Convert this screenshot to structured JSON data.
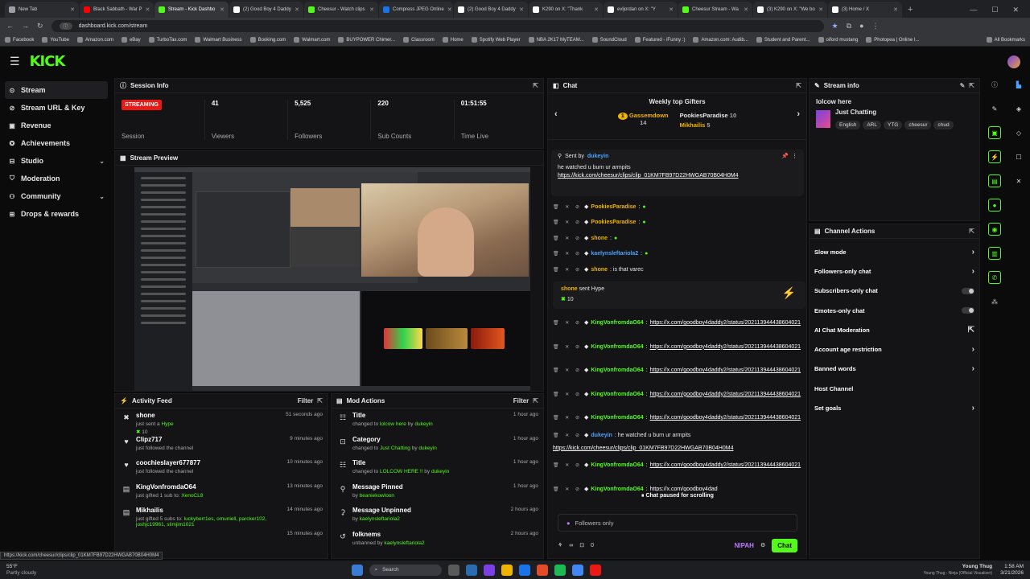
{
  "browser": {
    "tabs": [
      {
        "title": "New Tab",
        "color": "#9aa0a6",
        "active": false
      },
      {
        "title": "Black Sabbath - War P",
        "color": "#ff0000",
        "active": false
      },
      {
        "title": "Stream - Kick Dashbo",
        "color": "#53fc18",
        "active": true
      },
      {
        "title": "(2) Good Boy 4 Daddy",
        "color": "#ffffff",
        "active": false
      },
      {
        "title": "Cheesur - Watch clips",
        "color": "#53fc18",
        "active": false
      },
      {
        "title": "Compress JPEG Online",
        "color": "#1a73e8",
        "active": false
      },
      {
        "title": "(2) Good Boy 4 Daddy",
        "color": "#ffffff",
        "active": false
      },
      {
        "title": "K290 on X: \"Thank",
        "color": "#ffffff",
        "active": false
      },
      {
        "title": "evljordan on X: \"Y",
        "color": "#ffffff",
        "active": false
      },
      {
        "title": "Cheesur Stream - Wa",
        "color": "#53fc18",
        "active": false
      },
      {
        "title": "(3) K290 on X: \"We bo",
        "color": "#ffffff",
        "active": false
      },
      {
        "title": "(3) Home / X",
        "color": "#ffffff",
        "active": false
      }
    ],
    "url": "dashboard.kick.com/stream",
    "bookmarks": [
      "Facebook",
      "YouTube",
      "Amazon.com",
      "eBay",
      "TurboTax.com",
      "Walmart Business",
      "Booking.com",
      "Walmart.com",
      "BUYPOWER Chimer...",
      "Classroom",
      "Home",
      "Spotify Web Player",
      "NBA 2K17 MyTEAM...",
      "SoundCloud",
      "Featured - iFunny :)",
      "Amazon.com: Audib...",
      "Student and Parent...",
      "oiford mustang",
      "Photopea | Online I...",
      "All Bookmarks"
    ]
  },
  "app": {
    "logo": "KICK"
  },
  "nav": [
    {
      "label": "Stream",
      "icon": "stream-icon",
      "glyph": "⊙",
      "active": true,
      "expand": false
    },
    {
      "label": "Stream URL & Key",
      "icon": "key-icon",
      "glyph": "⊘",
      "active": false,
      "expand": false
    },
    {
      "label": "Revenue",
      "icon": "revenue-icon",
      "glyph": "▣",
      "active": false,
      "expand": false
    },
    {
      "label": "Achievements",
      "icon": "trophy-icon",
      "glyph": "✪",
      "active": false,
      "expand": false
    },
    {
      "label": "Studio",
      "icon": "studio-icon",
      "glyph": "⊟",
      "active": false,
      "expand": true
    },
    {
      "label": "Moderation",
      "icon": "shield-icon",
      "glyph": "⛉",
      "active": false,
      "expand": false
    },
    {
      "label": "Community",
      "icon": "community-icon",
      "glyph": "⚇",
      "active": false,
      "expand": true
    },
    {
      "label": "Drops & rewards",
      "icon": "gift-icon",
      "glyph": "⊞",
      "active": false,
      "expand": false
    }
  ],
  "session": {
    "title": "Session Info",
    "status": "STREAMING",
    "status_label": "Session",
    "stats": [
      {
        "value": "41",
        "label": "Viewers"
      },
      {
        "value": "5,525",
        "label": "Followers"
      },
      {
        "value": "220",
        "label": "Sub Counts"
      },
      {
        "value": "01:51:55",
        "label": "Time Live"
      }
    ]
  },
  "preview": {
    "title": "Stream Preview"
  },
  "activity": {
    "title": "Activity Feed",
    "filter": "Filter",
    "items": [
      {
        "icon": "hype-icon",
        "glyph": "✖",
        "name": "shone",
        "sub": "just sent a ",
        "sub_hl": "Hype",
        "extra": "10",
        "time": "51 seconds ago"
      },
      {
        "icon": "heart-icon",
        "glyph": "♥",
        "name": "Clipz717",
        "sub": "just followed the channel",
        "sub_hl": "",
        "extra": "",
        "time": "9 minutes ago"
      },
      {
        "icon": "heart-icon",
        "glyph": "♥",
        "name": "coochieslayer677877",
        "sub": "just followed the channel",
        "sub_hl": "",
        "extra": "",
        "time": "10 minutes ago"
      },
      {
        "icon": "gift-icon",
        "glyph": "▤",
        "name": "KingVonfromdaO64",
        "sub": "just gifted 1 sub to: ",
        "sub_hl": "XenoCL8",
        "extra": "",
        "time": "13 minutes ago"
      },
      {
        "icon": "gift-icon",
        "glyph": "▤",
        "name": "Mikhailis",
        "sub": "just gifted 5 subs to: ",
        "sub_hl": "luckyberr1es, omuniell, parcker102, joshjc19961, slimjim1021",
        "extra": "",
        "time": "14 minutes ago"
      },
      {
        "icon": "more-icon",
        "glyph": "",
        "name": "",
        "sub": "",
        "sub_hl": "",
        "extra": "",
        "time": "15 minutes ago"
      }
    ]
  },
  "modactions": {
    "title": "Mod Actions",
    "filter": "Filter",
    "items": [
      {
        "icon": "title-icon",
        "glyph": "☷",
        "name": "Title",
        "pre": "changed to ",
        "val": "lolcow here",
        "by": " by ",
        "user": "dukeyin",
        "time": "1 hour ago"
      },
      {
        "icon": "category-icon",
        "glyph": "⊡",
        "name": "Category",
        "pre": "changed to ",
        "val": "Just Chatting",
        "by": " by ",
        "user": "dukeyin",
        "time": "1 hour ago"
      },
      {
        "icon": "title-icon",
        "glyph": "☷",
        "name": "Title",
        "pre": "changed to ",
        "val": "LOLCOW HERE !!",
        "by": " by ",
        "user": "dukeyin",
        "time": "1 hour ago"
      },
      {
        "icon": "pin-icon",
        "glyph": "⚲",
        "name": "Message Pinned",
        "pre": "by ",
        "val": "",
        "by": "",
        "user": "beaniekowloon",
        "time": "1 hour ago"
      },
      {
        "icon": "unpin-icon",
        "glyph": "⚳",
        "name": "Message Unpinned",
        "pre": "by ",
        "val": "",
        "by": "",
        "user": "kaelynsleftariola2",
        "time": "2 hours ago"
      },
      {
        "icon": "unban-icon",
        "glyph": "↺",
        "name": "folknems",
        "pre": "unbanned by ",
        "val": "",
        "by": "",
        "user": "kaelynsleftariola2",
        "time": "2 hours ago"
      }
    ]
  },
  "chat": {
    "title": "Chat",
    "gifters_title": "Weekly top Gifters",
    "gifters": [
      {
        "rank": "1",
        "name": "Gassemdown",
        "count": "14"
      },
      {
        "rank": "",
        "name": "PookiesParadise",
        "count": "10"
      },
      {
        "rank": "",
        "name": "Mikhailis",
        "count": "5"
      }
    ],
    "pinned": {
      "sent_by": "Sent by",
      "user": "dukeyin",
      "text": "he watched u burn ur armpits ",
      "link": "https://kick.com/cheesur/clips/clip_01KM7FB97D22HWGAB70B04H0M4"
    },
    "messages": [
      {
        "user": "PookiesParadise",
        "color": "o",
        "text": ":",
        "link": ""
      },
      {
        "user": "PookiesParadise",
        "color": "o",
        "text": ":",
        "link": ""
      },
      {
        "user": "shone",
        "color": "o",
        "text": ":",
        "link": ""
      },
      {
        "user": "kaelynsleftariola2",
        "color": "b",
        "text": ":",
        "link": ""
      },
      {
        "user": "shone",
        "color": "o",
        "text": ": is that varec",
        "link": ""
      }
    ],
    "hype": {
      "user": "shone",
      "text": " sent Hype",
      "amount": "10"
    },
    "messages2": [
      {
        "user": "KingVonfromdaO64",
        "text": ":",
        "link": "https://x.com/goodboy4daddy2/status/2021139444386040​21"
      },
      {
        "user": "KingVonfromdaO64",
        "text": ":",
        "link": "https://x.com/goodboy4daddy2/status/2021139444386040​21"
      },
      {
        "user": "KingVonfromdaO64",
        "text": ":",
        "link": "https://x.com/goodboy4daddy2/status/2021139444386040​21"
      },
      {
        "user": "KingVonfromdaO64",
        "text": ":",
        "link": "https://x.com/goodboy4daddy2/status/2021139444386040​21"
      },
      {
        "user": "KingVonfromdaO64",
        "text": ":",
        "link": "https://x.com/goodboy4daddy2/status/2021139444386040​21"
      },
      {
        "user": "dukeyin",
        "text": ": he watched u burn ur armpits ",
        "link": "https://kick.com/cheesur/clips/clip_01KM7FB97D22HWGAB70B04H0M4"
      },
      {
        "user": "KingVonfromdaO64",
        "text": ":",
        "link": "https://x.com/goodboy4daddy2/status/2021139444386040​21"
      },
      {
        "user": "KingVonfromdaO64",
        "text": ":",
        "link": "https://x.com/goodboy4dad"
      }
    ],
    "paused": "Chat paused for scrolling",
    "input_placeholder": "Followers only",
    "count": "0",
    "emote": "NIPAH",
    "send": "Chat"
  },
  "streaminfo": {
    "title": "Stream info",
    "stream_title": "lolcow here",
    "category": "Just Chatting",
    "tags": [
      "English",
      "ARL",
      "YTG",
      "cheesur",
      "chud"
    ]
  },
  "channel_actions": {
    "title": "Channel Actions",
    "items": [
      {
        "label": "Slow mode",
        "ctl": "chev"
      },
      {
        "label": "Followers-only chat",
        "ctl": "chev"
      },
      {
        "label": "Subscribers-only chat",
        "ctl": "toggle"
      },
      {
        "label": "Emotes-only chat",
        "ctl": "toggle"
      },
      {
        "label": "AI Chat Moderation",
        "ctl": "ext"
      },
      {
        "label": "Account age restriction",
        "ctl": "chev"
      },
      {
        "label": "Banned words",
        "ctl": "chev"
      },
      {
        "label": "Host Channel",
        "ctl": "none"
      },
      {
        "label": "Set goals",
        "ctl": "chev"
      }
    ]
  },
  "status_url": "https://kick.com/cheesur/clips/clip_01KM7FB97D22HWGAB70B04H0M4",
  "taskbar": {
    "weather_temp": "55°F",
    "weather_text": "Partly cloudy",
    "search": "Search",
    "time": "1:58 AM",
    "date": "3/21/2026",
    "now_playing": "Young Thug",
    "now_playing_sub": "Young Thug - Ninja (Official Visualizer)"
  }
}
